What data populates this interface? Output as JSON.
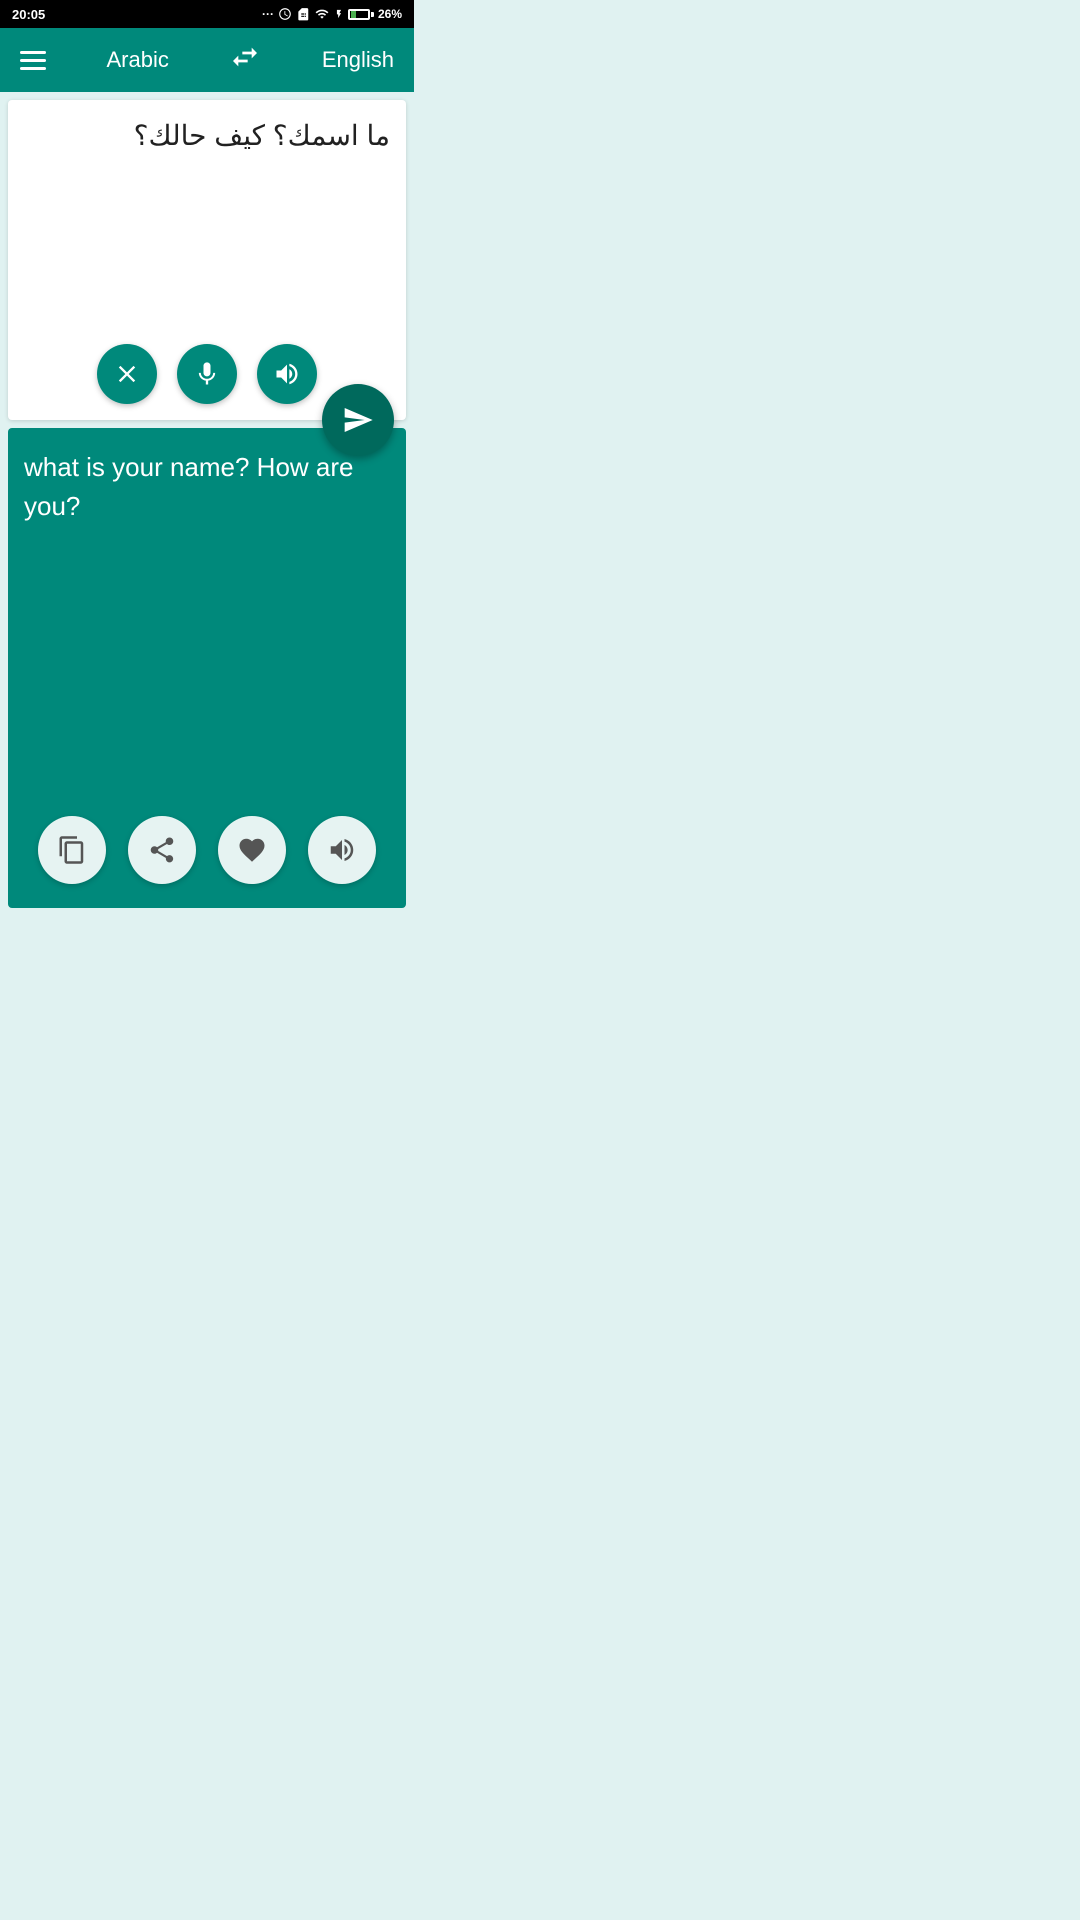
{
  "statusBar": {
    "time": "20:05",
    "battery": "26%"
  },
  "appBar": {
    "menuLabel": "menu",
    "sourceLanguage": "Arabic",
    "targetLanguage": "English",
    "swapLabel": "swap languages"
  },
  "sourcePanel": {
    "text": "ما اسمك؟ كيف حالك؟",
    "clearLabel": "clear",
    "micLabel": "microphone",
    "speakLabel": "speak",
    "translateLabel": "translate"
  },
  "translationPanel": {
    "text": "what is your name? How are you?",
    "copyLabel": "copy",
    "shareLabel": "share",
    "favoriteLabel": "favorite",
    "speakLabel": "speak translation"
  }
}
